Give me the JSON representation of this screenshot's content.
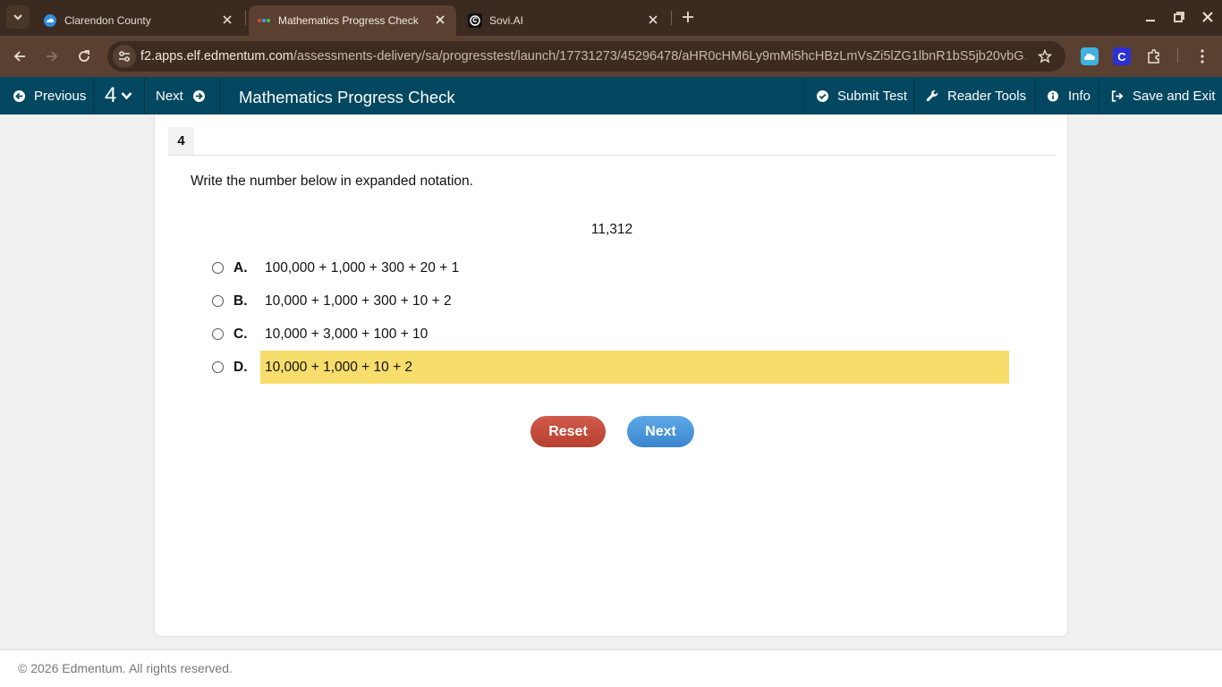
{
  "browser": {
    "tabs": [
      {
        "title": "Clarendon County",
        "favicon": "cloud-icon",
        "active": false
      },
      {
        "title": "Mathematics Progress Check",
        "favicon": "edmentum-icon",
        "active": true
      },
      {
        "title": "Sovi.AI",
        "favicon": "sovi-icon",
        "active": false
      }
    ],
    "url_host": "f2.apps.elf.edmentum.com",
    "url_path": "/assessments-delivery/sa/progresstest/launch/17731273/45296478/aHR0cHM6Ly9mMi5hcHBzLmVsZi5lZG1lbnR1bS5jb20vbG…",
    "extensions": [
      {
        "name": "cloud-extension-icon",
        "color": "#3fb2e0"
      },
      {
        "name": "c-extension-icon",
        "label": "C",
        "color": "#2b2fd6"
      }
    ]
  },
  "header": {
    "previous_label": "Previous",
    "question_number": "4",
    "next_label": "Next",
    "title": "Mathematics Progress Check",
    "submit_label": "Submit Test",
    "reader_tools_label": "Reader Tools",
    "info_label": "Info",
    "save_exit_label": "Save and Exit",
    "bg_color": "#034860"
  },
  "question": {
    "number": "4",
    "prompt": "Write the number below in expanded notation.",
    "value": "11,312",
    "choices": [
      {
        "letter": "A.",
        "text": "100,000 + 1,000 + 300 + 20 + 1",
        "highlighted": false
      },
      {
        "letter": "B.",
        "text": "10,000 + 1,000 + 300 + 10 + 2",
        "highlighted": false
      },
      {
        "letter": "C.",
        "text": "10,000 + 3,000 + 100 + 10",
        "highlighted": false
      },
      {
        "letter": "D.",
        "text": "10,000 + 1,000 + 10 + 2",
        "highlighted": true
      }
    ],
    "highlight_color": "#f7dd6c"
  },
  "buttons": {
    "reset_label": "Reset",
    "next_label": "Next"
  },
  "footer": {
    "copyright": "© 2026 Edmentum. All rights reserved."
  }
}
